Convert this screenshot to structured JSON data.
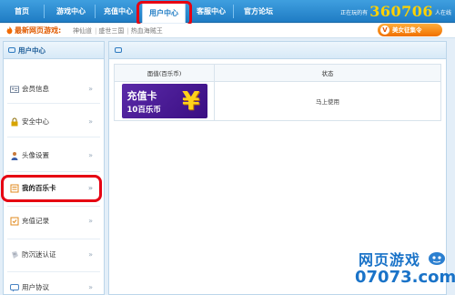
{
  "nav": {
    "items": [
      "首页",
      "游戏中心",
      "充值中心",
      "用户中心",
      "客服中心",
      "官方论坛"
    ],
    "active_index": 3,
    "players_prefix": "正在玩的有",
    "players_count": "360706",
    "players_suffix": "人在线"
  },
  "strip": {
    "hot_label": "最新网页游戏:",
    "games": [
      "神仙道",
      "盛世三国",
      "热血海贼王"
    ],
    "gift_button": "美女征集令",
    "gift_badge": "V"
  },
  "sidebar": {
    "title": "用户中心",
    "items": [
      {
        "label": "会员信息",
        "icon": "member-card-icon"
      },
      {
        "label": "安全中心",
        "icon": "lock-icon"
      },
      {
        "label": "头像设置",
        "icon": "person-icon"
      },
      {
        "label": "我的百乐卡",
        "icon": "card-icon"
      },
      {
        "label": "充值记录",
        "icon": "record-icon"
      },
      {
        "label": "防沉迷认证",
        "icon": "shield-icon"
      },
      {
        "label": "用户协议",
        "icon": "chat-icon"
      }
    ],
    "active_index": 3
  },
  "main": {
    "columns": [
      "面值(百乐币)",
      "状态"
    ],
    "rows": [
      {
        "card_line1": "充值卡",
        "card_line2": "10百乐币",
        "card_symbol": "¥",
        "status": "马上使用"
      }
    ]
  },
  "watermark": {
    "line1": "网页游戏",
    "line2": "07073.com"
  },
  "colors": {
    "nav_blue": "#1f7cc4",
    "highlight_red": "#e60012",
    "card_purple": "#4a1c96",
    "gift_orange": "#f07000"
  }
}
